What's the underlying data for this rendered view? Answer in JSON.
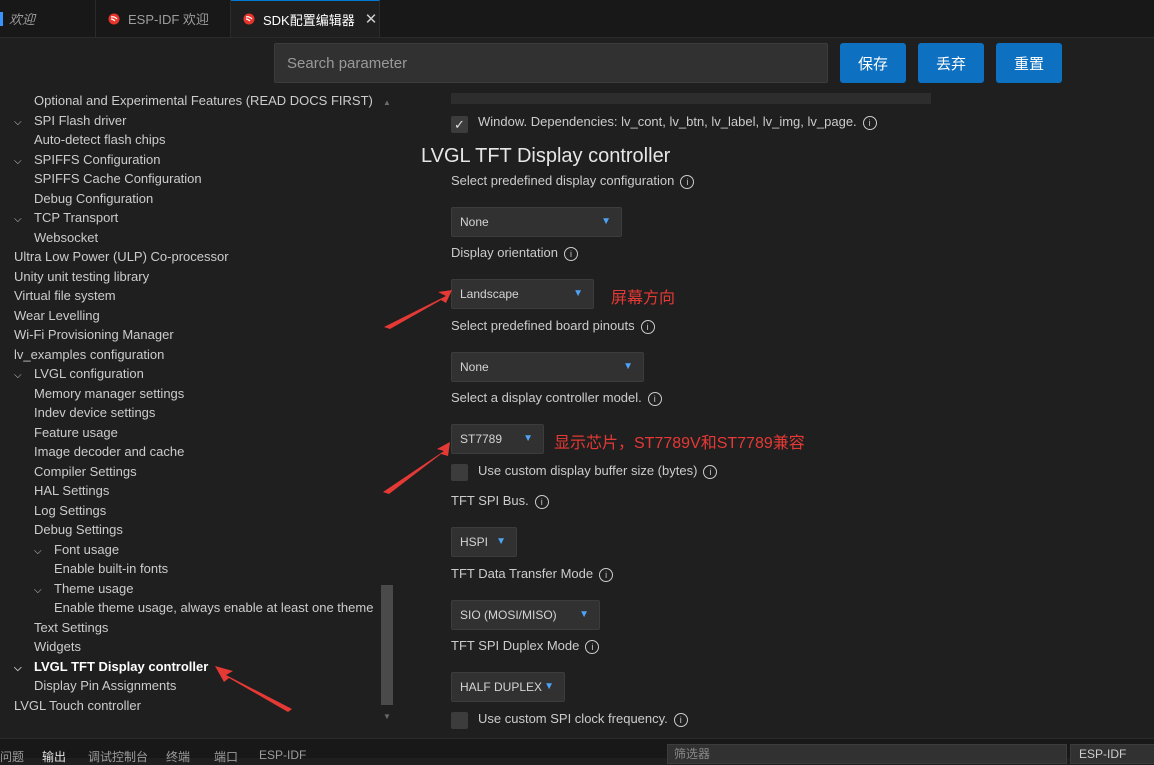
{
  "tabs": [
    {
      "label": "欢迎",
      "active": false
    },
    {
      "label": "ESP-IDF 欢迎",
      "active": false
    },
    {
      "label": "SDK配置编辑器",
      "active": true
    }
  ],
  "toolbar": {
    "search_placeholder": "Search parameter",
    "save_label": "保存",
    "discard_label": "丢弃",
    "reset_label": "重置"
  },
  "sidebar": {
    "items": [
      {
        "label": "Optional and Experimental Features (READ DOCS FIRST)",
        "level": 1,
        "expanded": null
      },
      {
        "label": "SPI Flash driver",
        "level": 0,
        "expanded": true
      },
      {
        "label": "Auto-detect flash chips",
        "level": 1,
        "expanded": null
      },
      {
        "label": "SPIFFS Configuration",
        "level": 0,
        "expanded": true
      },
      {
        "label": "SPIFFS Cache Configuration",
        "level": 1,
        "expanded": null
      },
      {
        "label": "Debug Configuration",
        "level": 1,
        "expanded": null
      },
      {
        "label": "TCP Transport",
        "level": 0,
        "expanded": true
      },
      {
        "label": "Websocket",
        "level": 1,
        "expanded": null
      },
      {
        "label": "Ultra Low Power (ULP) Co-processor",
        "level": -1,
        "expanded": null
      },
      {
        "label": "Unity unit testing library",
        "level": -1,
        "expanded": null
      },
      {
        "label": "Virtual file system",
        "level": -1,
        "expanded": null
      },
      {
        "label": "Wear Levelling",
        "level": -1,
        "expanded": null
      },
      {
        "label": "Wi-Fi Provisioning Manager",
        "level": -1,
        "expanded": null
      },
      {
        "label": "lv_examples configuration",
        "level": -1,
        "expanded": null
      },
      {
        "label": "LVGL configuration",
        "level": 0,
        "expanded": true
      },
      {
        "label": "Memory manager settings",
        "level": 1,
        "expanded": null
      },
      {
        "label": "Indev device settings",
        "level": 1,
        "expanded": null
      },
      {
        "label": "Feature usage",
        "level": 1,
        "expanded": null
      },
      {
        "label": "Image decoder and cache",
        "level": 1,
        "expanded": null
      },
      {
        "label": "Compiler Settings",
        "level": 1,
        "expanded": null
      },
      {
        "label": "HAL Settings",
        "level": 1,
        "expanded": null
      },
      {
        "label": "Log Settings",
        "level": 1,
        "expanded": null
      },
      {
        "label": "Debug Settings",
        "level": 1,
        "expanded": null
      },
      {
        "label": "Font usage",
        "level": 2,
        "expanded": true
      },
      {
        "label": "Enable built-in fonts",
        "level": 3,
        "expanded": null
      },
      {
        "label": "Theme usage",
        "level": 2,
        "expanded": true
      },
      {
        "label": "Enable theme usage, always enable at least one theme",
        "level": 3,
        "expanded": null
      },
      {
        "label": "Text Settings",
        "level": 1,
        "expanded": null
      },
      {
        "label": "Widgets",
        "level": 1,
        "expanded": null
      },
      {
        "label": "LVGL TFT Display controller",
        "level": 0,
        "expanded": true,
        "selected": true
      },
      {
        "label": "Display Pin Assignments",
        "level": 1,
        "expanded": null
      },
      {
        "label": "LVGL Touch controller",
        "level": -1,
        "expanded": null
      }
    ]
  },
  "main": {
    "window_dep": "Window. Dependencies: lv_cont, lv_btn, lv_label, lv_img, lv_page.",
    "section_title": "LVGL TFT Display controller",
    "predefined_label": "Select predefined display configuration",
    "predefined_value": "None",
    "orientation_label": "Display orientation",
    "orientation_value": "Landscape",
    "board_label": "Select predefined board pinouts",
    "board_value": "None",
    "controller_label": "Select a display controller model.",
    "controller_value": "ST7789",
    "custom_buffer_label": "Use custom display buffer size (bytes)",
    "spi_bus_label": "TFT SPI Bus.",
    "spi_bus_value": "HSPI",
    "transfer_mode_label": "TFT Data Transfer Mode",
    "transfer_mode_value": "SIO (MOSI/MISO)",
    "duplex_label": "TFT SPI Duplex Mode",
    "duplex_value": "HALF DUPLEX",
    "clock_label": "Use custom SPI clock frequency."
  },
  "annotations": {
    "orientation_note": "屏幕方向",
    "chip_note": "显示芯片，ST7789V和ST7789兼容",
    "arrow_color": "#e53935"
  },
  "bottom_panel": {
    "tabs": [
      "问题",
      "输出",
      "调试控制台",
      "终端",
      "端口",
      "ESP-IDF"
    ],
    "active_tab": "输出",
    "filter_placeholder": "筛选器",
    "channel_value": "ESP-IDF"
  },
  "colors": {
    "accent": "#0e70c0",
    "background": "#1f1f1f",
    "annotation": "#e53935"
  }
}
